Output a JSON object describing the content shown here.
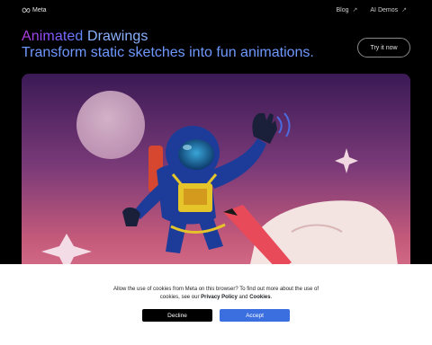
{
  "header": {
    "logo_text": "Meta",
    "logo_icon": "meta-infinity-icon",
    "nav": [
      {
        "label": "Blog",
        "icon": "external-link-icon"
      },
      {
        "label": "AI Demos",
        "icon": "external-link-icon"
      }
    ]
  },
  "hero": {
    "title_accent": "Animated",
    "title_rest": "Drawings",
    "subtitle": "Transform static sketches into fun animations.",
    "cta_label": "Try it now",
    "illustration": "astronaut-sketch-illustration"
  },
  "cookie_banner": {
    "text_before": "Allow the use of cookies from Meta on this browser? To find out more about the use of cookies, see our ",
    "privacy_link": "Privacy Policy",
    "text_and": " and ",
    "cookies_link": "Cookies",
    "text_end": ".",
    "decline_label": "Decline",
    "accept_label": "Accept"
  },
  "colors": {
    "background": "#000000",
    "accent_gradient_start": "#b23ad8",
    "accent_blue": "#6f98ff",
    "accept_button": "#3b6fe0"
  }
}
